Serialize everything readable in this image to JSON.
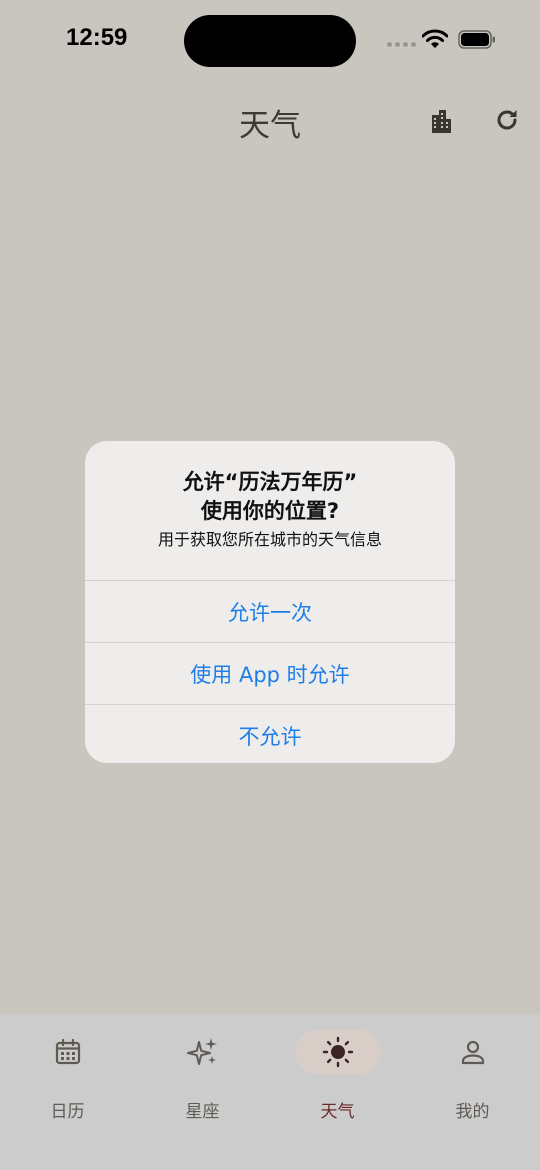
{
  "status_bar": {
    "time": "12:59"
  },
  "header": {
    "title": "天气",
    "city_button_icon": "city-buildings-icon",
    "refresh_button_icon": "refresh-icon"
  },
  "alert": {
    "title_line1": "允许“历法万年历”",
    "title_line2": "使用你的位置?",
    "message": "用于获取您所在城市的天气信息",
    "actions": [
      {
        "label": "允许一次"
      },
      {
        "label": "使用 App 时允许"
      },
      {
        "label": "不允许"
      }
    ],
    "action_color": "#1d7ee8"
  },
  "tab_bar": {
    "active_tab": "天气",
    "tabs": [
      {
        "label": "日历",
        "icon": "calendar-icon"
      },
      {
        "label": "星座",
        "icon": "sparkles-icon"
      },
      {
        "label": "天气",
        "icon": "sun-icon"
      },
      {
        "label": "我的",
        "icon": "person-icon"
      }
    ]
  },
  "colors": {
    "background": "#c9c6bf",
    "tab_bar": "#cccccc",
    "active_tab_text": "#6a2a2a",
    "active_tab_pill": "#d9cdc7"
  }
}
